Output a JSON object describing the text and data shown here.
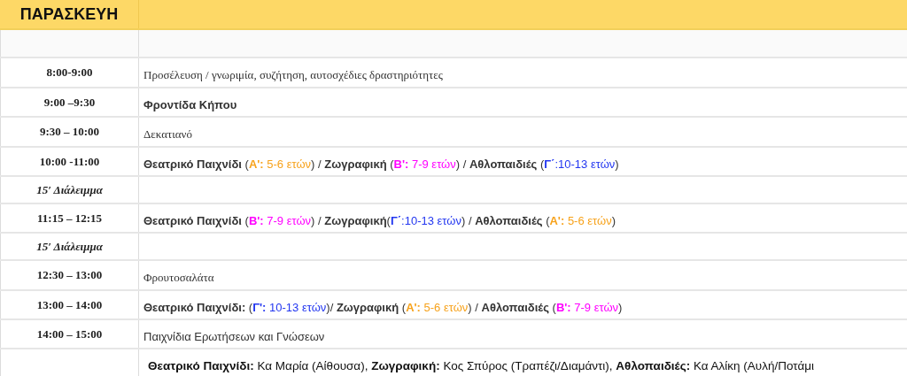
{
  "header": {
    "day": "ΠΑΡΑΣΚΕΥΗ"
  },
  "rows": [
    {
      "time": "",
      "kind": "blank",
      "segments": []
    },
    {
      "time": "8:00-9:00",
      "kind": "serif",
      "segments": [
        {
          "text": "Προσέλευση / γνωριμία, συζήτηση, αυτοσχέδιες δραστηριότητες"
        }
      ]
    },
    {
      "time": "9:00 –9:30",
      "kind": "sans",
      "segments": [
        {
          "text": "Φροντίδα Κήπου",
          "bold": true
        }
      ]
    },
    {
      "time": "9:30 – 10:00",
      "kind": "serif",
      "segments": [
        {
          "text": "Δεκατιανό"
        }
      ]
    },
    {
      "time": "10:00 -11:00",
      "kind": "sans",
      "segments": [
        {
          "text": "Θεατρικό Παιχνίδι",
          "bold": true
        },
        {
          "text": " ("
        },
        {
          "text": "Α':",
          "bold": true,
          "color": "#f7a21b"
        },
        {
          "text": " 5-6 ετών",
          "color": "#f7a21b"
        },
        {
          "text": ") / "
        },
        {
          "text": "Ζωγραφική",
          "bold": true
        },
        {
          "text": " ("
        },
        {
          "text": "Β':",
          "bold": true,
          "color": "#ff00ff"
        },
        {
          "text": " 7-9 ετών",
          "color": "#ff00ff"
        },
        {
          "text": ")  / "
        },
        {
          "text": "Αθλοπαιδιές",
          "bold": true
        },
        {
          "text": " ("
        },
        {
          "text": "Γ΄",
          "bold": true,
          "color": "#2236f0"
        },
        {
          "text": ":10-13 ετών",
          "color": "#2236f0"
        },
        {
          "text": ")"
        }
      ]
    },
    {
      "time": "15′ Διάλειμμα",
      "kind": "break",
      "segments": []
    },
    {
      "time": "11:15 – 12:15",
      "kind": "sans",
      "segments": [
        {
          "text": "Θεατρικό Παιχνίδι",
          "bold": true
        },
        {
          "text": " ("
        },
        {
          "text": "Β':",
          "bold": true,
          "color": "#ff00ff"
        },
        {
          "text": " 7-9 ετών",
          "color": "#ff00ff"
        },
        {
          "text": ") / "
        },
        {
          "text": "Ζωγραφική",
          "bold": true
        },
        {
          "text": "("
        },
        {
          "text": "Γ΄",
          "bold": true,
          "color": "#2236f0"
        },
        {
          "text": ":10-13 ετών",
          "color": "#2236f0"
        },
        {
          "text": ") /  "
        },
        {
          "text": "Αθλοπαιδιές",
          "bold": true
        },
        {
          "text": " ("
        },
        {
          "text": "Α':",
          "bold": true,
          "color": "#f7a21b"
        },
        {
          "text": " 5-6 ετών",
          "color": "#f7a21b"
        },
        {
          "text": ")"
        }
      ]
    },
    {
      "time": "15′ Διάλειμμα",
      "kind": "break",
      "segments": []
    },
    {
      "time": "12:30 – 13:00",
      "kind": "serif",
      "segments": [
        {
          "text": "Φρουτοσαλάτα"
        }
      ]
    },
    {
      "time": "13:00 – 14:00",
      "kind": "sans",
      "segments": [
        {
          "text": "Θεατρικό Παιχνίδι:",
          "bold": true
        },
        {
          "text": " ("
        },
        {
          "text": "Γ':",
          "bold": true,
          "color": "#2236f0"
        },
        {
          "text": " 10-13 ετών",
          "color": "#2236f0"
        },
        {
          "text": ")/  "
        },
        {
          "text": "Ζωγραφική",
          "bold": true
        },
        {
          "text": " ("
        },
        {
          "text": "Α':",
          "bold": true,
          "color": "#f7a21b"
        },
        {
          "text": " 5-6 ετών",
          "color": "#f7a21b"
        },
        {
          "text": ") / "
        },
        {
          "text": "Αθλοπαιδιές",
          "bold": true
        },
        {
          "text": " ("
        },
        {
          "text": "Β':",
          "bold": true,
          "color": "#ff00ff"
        },
        {
          "text": " 7-9 ετών",
          "color": "#ff00ff"
        },
        {
          "text": ")"
        }
      ]
    },
    {
      "time": "14:00 – 15:00",
      "kind": "sans",
      "segments": [
        {
          "text": "Παιχνίδια Ερωτήσεων και Γνώσεων"
        }
      ]
    },
    {
      "time": "",
      "kind": "footer",
      "segments": [
        {
          "text": "Θεατρικό Παιχνίδι:",
          "bold": true
        },
        {
          "text": " Κα Μαρία (Αίθουσα), "
        },
        {
          "text": "Ζωγραφική:",
          "bold": true
        },
        {
          "text": " Κος Σπύρος (Τραπέζι/Διαμάντι), "
        },
        {
          "text": "Αθλοπαιδιές:",
          "bold": true
        },
        {
          "text": " Κα Αλίκη (Αυλή/Ποτάμι"
        }
      ]
    }
  ]
}
